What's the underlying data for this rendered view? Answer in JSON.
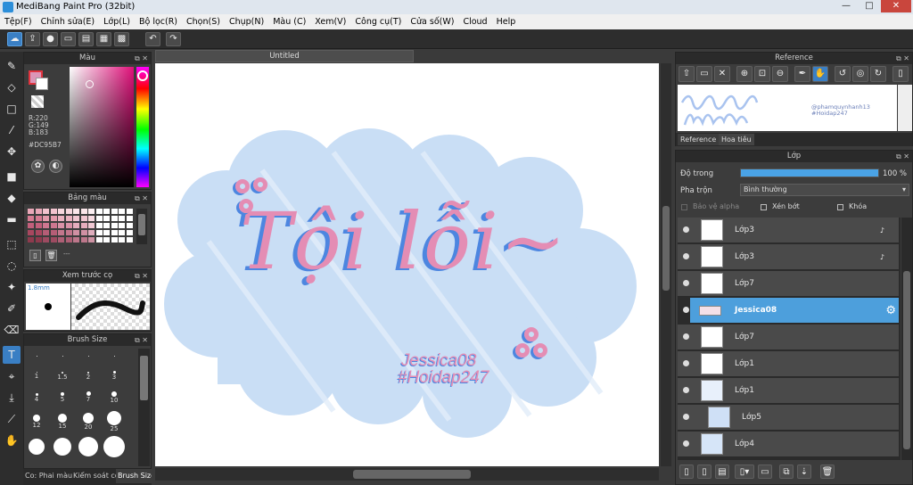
{
  "window": {
    "title": "MediBang Paint Pro (32bit)",
    "min": "—",
    "max": "□",
    "close": "✕"
  },
  "menu": [
    "Tệp(F)",
    "Chỉnh sửa(E)",
    "Lớp(L)",
    "Bộ lọc(R)",
    "Chọn(S)",
    "Chụp(N)",
    "Màu (C)",
    "Xem(V)",
    "Công cụ(T)",
    "Cửa số(W)",
    "Cloud",
    "Help"
  ],
  "toolbar": {
    "icons": [
      "cloud-icon",
      "share-icon",
      "comment-icon",
      "chat-icon",
      "page-icon",
      "grid-page-icon",
      "tiles-icon",
      "undo-icon",
      "redo-icon"
    ]
  },
  "colors": {
    "accent": "#3a7fc4",
    "selected_color": "#DC95B7",
    "cloud": "#c9def5"
  },
  "color_panel": {
    "title": "Màu",
    "r": "R:220",
    "g": "G:149",
    "b": "B:183",
    "hex": "#DC95B7"
  },
  "palette_panel": {
    "title": "Bảng màu",
    "dash": "---"
  },
  "brush_preview_panel": {
    "title": "Xem trước cọ",
    "size": "1.8mm"
  },
  "brush_size_panel": {
    "title": "Brush Size",
    "sizes": [
      "1",
      "1.5",
      "2",
      "3",
      "4",
      "5",
      "7",
      "10",
      "12",
      "15",
      "20",
      "25"
    ]
  },
  "bottom_tabs": [
    "Co: Phai màu",
    "Kiểm soát cọ",
    "Brush Size"
  ],
  "canvas": {
    "tab": "Untitled",
    "text_main": "Tội lỗi~",
    "text_sig1": "Jessica08",
    "text_sig2": "#Hoidap247"
  },
  "reference_panel": {
    "title": "Reference",
    "handle": "@phamquynhanh13",
    "tag": "#Hoidap247",
    "tabs": [
      "Reference",
      "Hoa tiêu"
    ]
  },
  "layer_panel": {
    "title": "Lớp",
    "opacity_label": "Độ trong",
    "opacity_value": "100 %",
    "opacity": 1.0,
    "blend_label": "Pha trộn",
    "blend_value": "Bình thường",
    "protect_alpha": "Bảo vệ alpha",
    "clip": "Xén bớt",
    "lock": "Khóa",
    "layers": [
      {
        "name": "Lớp3",
        "selected": false
      },
      {
        "name": "Lớp3",
        "selected": false
      },
      {
        "name": "Lớp7",
        "selected": false
      },
      {
        "name": "Jessica08",
        "selected": true
      },
      {
        "name": "Lớp7",
        "selected": false
      },
      {
        "name": "Lớp1",
        "selected": false
      },
      {
        "name": "Lớp1",
        "selected": false
      },
      {
        "name": "Lớp5",
        "selected": false
      },
      {
        "name": "Lớp4",
        "selected": false
      }
    ]
  }
}
